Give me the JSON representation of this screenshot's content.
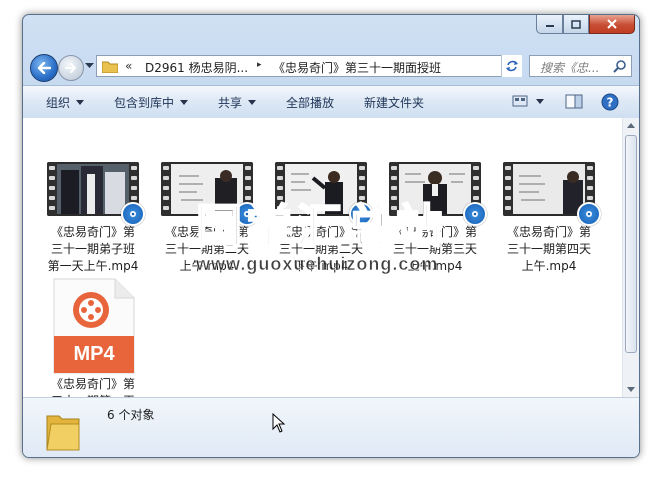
{
  "window": {
    "controls": {
      "minimize": "minimize",
      "maximize": "maximize",
      "close": "close"
    }
  },
  "nav": {
    "address_chevron": "«",
    "address_segment_1": "D2961 杨忠易阴...",
    "address_separator": "▸",
    "address_segment_2": "《忠易奇门》第三十一期面授班",
    "search_placeholder": "搜索《忠...",
    "icons": [
      "back-icon",
      "forward-icon",
      "folder-icon",
      "refresh-icon",
      "search-icon"
    ]
  },
  "toolbar": {
    "organize": "组织",
    "include_library": "包含到库中",
    "share": "共享",
    "play_all": "全部播放",
    "new_folder": "新建文件夹"
  },
  "files": [
    {
      "name_lines": [
        "《忠易奇门》第",
        "三十一期弟子班",
        "第一天上午.mp4"
      ],
      "type": "video",
      "scene": "people"
    },
    {
      "name_lines": [
        "《忠易奇门》第",
        "三十一期第二天",
        "上午.mp4"
      ],
      "type": "video",
      "scene": "board-right"
    },
    {
      "name_lines": [
        "《忠易奇门》第",
        "三十一期第二天",
        "下午.mp4"
      ],
      "type": "video",
      "scene": "teacher-center"
    },
    {
      "name_lines": [
        "《忠易奇门》第",
        "三十一期第三天",
        "上午.mp4"
      ],
      "type": "video",
      "scene": "teacher-center"
    },
    {
      "name_lines": [
        "《忠易奇门》第",
        "三十一期第四天",
        "上午.mp4"
      ],
      "type": "video",
      "scene": "board-right"
    },
    {
      "name_lines": [
        "《忠易奇门》第",
        "三十一期第一天"
      ],
      "type": "mp4-generic",
      "badge": "MP4"
    }
  ],
  "watermark": {
    "cn": "国学汇总站",
    "url": "www.guoxuehuizong.com"
  },
  "status": {
    "count": "6 个对象"
  },
  "colors": {
    "accent": "#2a6fc9",
    "mp4_badge": "#e8643a",
    "close_button": "#c84e33"
  }
}
